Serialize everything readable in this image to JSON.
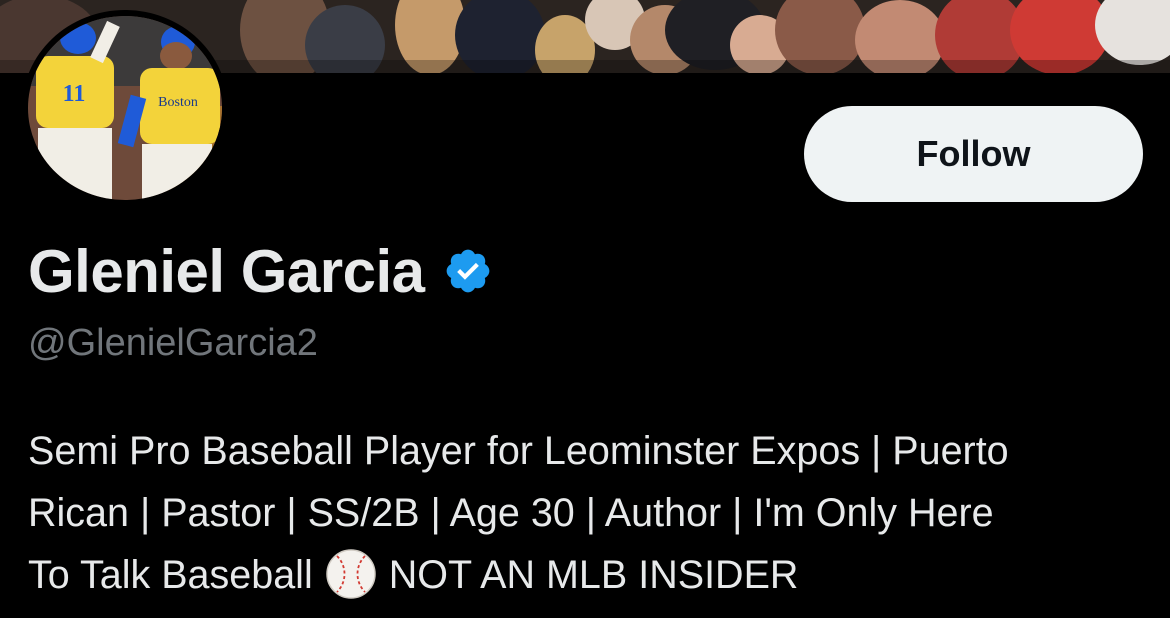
{
  "profile": {
    "display_name": "Gleniel Garcia",
    "handle": "@GlenielGarcia2",
    "follow_label": "Follow",
    "bio_lines": [
      "Semi Pro Baseball Player for Leominster Expos | Puerto",
      "Rican | Pastor | SS/2B | Age 30 | Author | I'm Only Here",
      "To Talk Baseball"
    ],
    "bio_tail": "NOT AN MLB INSIDER",
    "bio_emoji": "baseball-icon",
    "verified_icon": "verified-badge-icon",
    "avatar_jersey_number": "11",
    "avatar_jersey_text": "Boston"
  },
  "colors": {
    "background": "#000000",
    "text_primary": "#e7e9ea",
    "text_secondary": "#71767b",
    "follow_bg": "#eff3f4",
    "verified_blue": "#1d9bf0",
    "jersey_yellow": "#f3d33a",
    "helmet_blue": "#1f5bd8"
  }
}
